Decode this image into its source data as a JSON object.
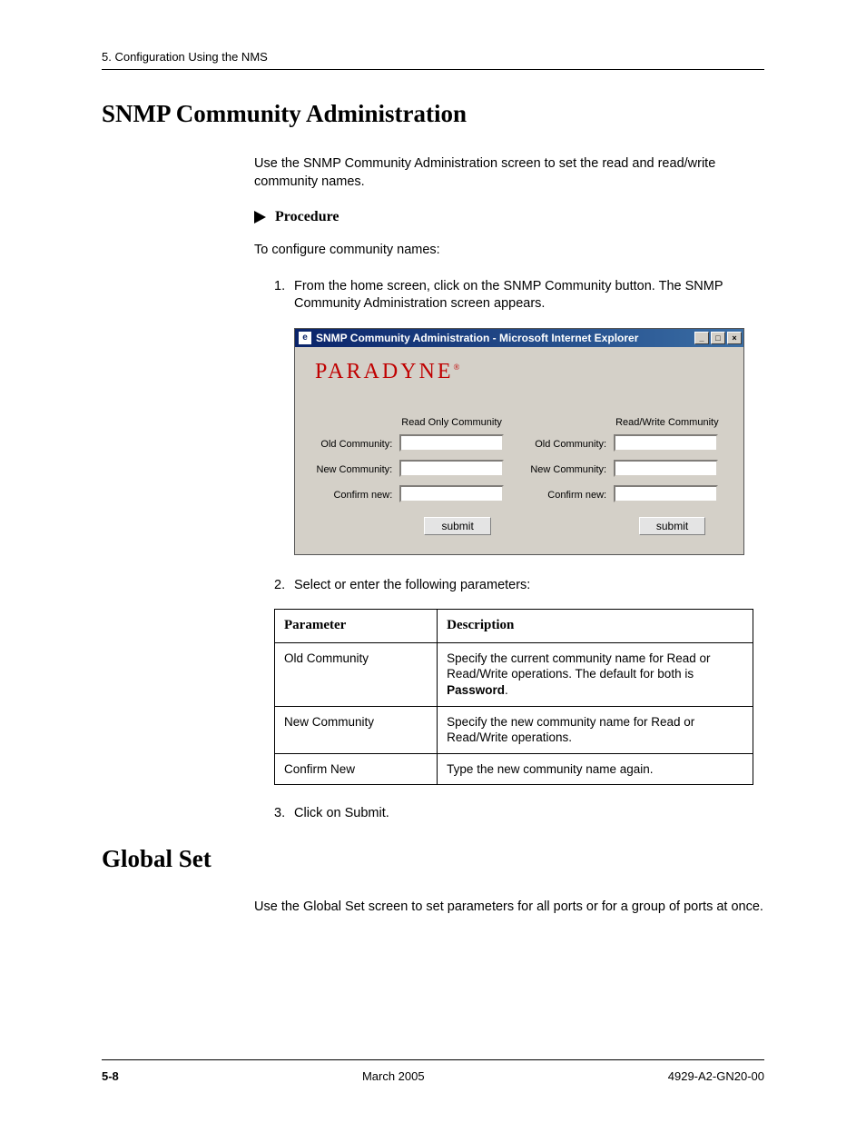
{
  "header": {
    "chapter": "5. Configuration Using the NMS"
  },
  "section1": {
    "title": "SNMP Community Administration",
    "intro": "Use the SNMP Community Administration screen to set the read and read/write community names.",
    "procedure_label": "Procedure",
    "procedure_intro": "To configure community names:",
    "steps": [
      {
        "num": "1.",
        "text": "From the home screen, click on the SNMP Community button. The SNMP Community Administration screen appears."
      },
      {
        "num": "2.",
        "text": "Select or enter the following parameters:"
      },
      {
        "num": "3.",
        "text": "Click on Submit."
      }
    ]
  },
  "screenshot": {
    "title": "SNMP Community Administration - Microsoft Internet Explorer",
    "brand": "PARADYNE",
    "col_titles": {
      "left": "Read Only Community",
      "right": "Read/Write Community"
    },
    "row_labels": {
      "old": "Old Community:",
      "new": "New Community:",
      "confirm": "Confirm new:"
    },
    "submit": "submit"
  },
  "param_table": {
    "headers": {
      "param": "Parameter",
      "desc": "Description"
    },
    "rows": [
      {
        "param": "Old Community",
        "desc_pre": "Specify the current community name for Read or Read/Write operations. The default for both is ",
        "desc_bold": "Password",
        "desc_post": "."
      },
      {
        "param": "New Community",
        "desc_pre": "Specify the new community name for Read or Read/Write operations.",
        "desc_bold": "",
        "desc_post": ""
      },
      {
        "param": "Confirm New",
        "desc_pre": "Type the new community name again.",
        "desc_bold": "",
        "desc_post": ""
      }
    ]
  },
  "section2": {
    "title": "Global Set",
    "intro": "Use the Global Set screen to set parameters for all ports or for a group of ports at once."
  },
  "footer": {
    "page": "5-8",
    "date": "March 2005",
    "doc": "4929-A2-GN20-00"
  }
}
